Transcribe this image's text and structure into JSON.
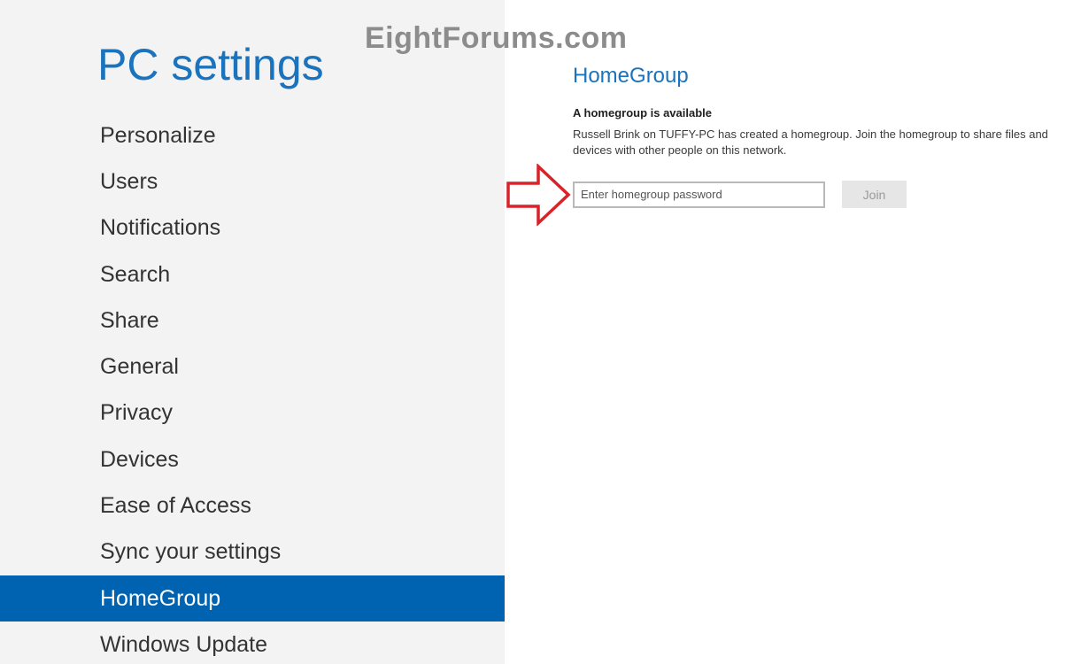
{
  "app": {
    "title": "PC settings"
  },
  "watermark": {
    "text": "EightForums.com"
  },
  "sidebar": {
    "items": [
      {
        "label": "Personalize",
        "active": false
      },
      {
        "label": "Users",
        "active": false
      },
      {
        "label": "Notifications",
        "active": false
      },
      {
        "label": "Search",
        "active": false
      },
      {
        "label": "Share",
        "active": false
      },
      {
        "label": "General",
        "active": false
      },
      {
        "label": "Privacy",
        "active": false
      },
      {
        "label": "Devices",
        "active": false
      },
      {
        "label": "Ease of Access",
        "active": false
      },
      {
        "label": "Sync your settings",
        "active": false
      },
      {
        "label": "HomeGroup",
        "active": true
      },
      {
        "label": "Windows Update",
        "active": false
      }
    ]
  },
  "main": {
    "section_title": "HomeGroup",
    "subheading": "A homegroup is available",
    "description": "Russell Brink on TUFFY-PC has created a homegroup. Join the homegroup to share files and devices with other people on this network.",
    "password_input": {
      "value": "",
      "placeholder": "Enter homegroup password"
    },
    "join_label": "Join"
  },
  "annotation": {
    "arrow_icon": "red-outline-arrow-right-icon",
    "color": "#d9232a"
  },
  "colors": {
    "accent": "#1a73bc",
    "selection": "#0063b1",
    "sidebar_bg": "#f3f3f3"
  }
}
